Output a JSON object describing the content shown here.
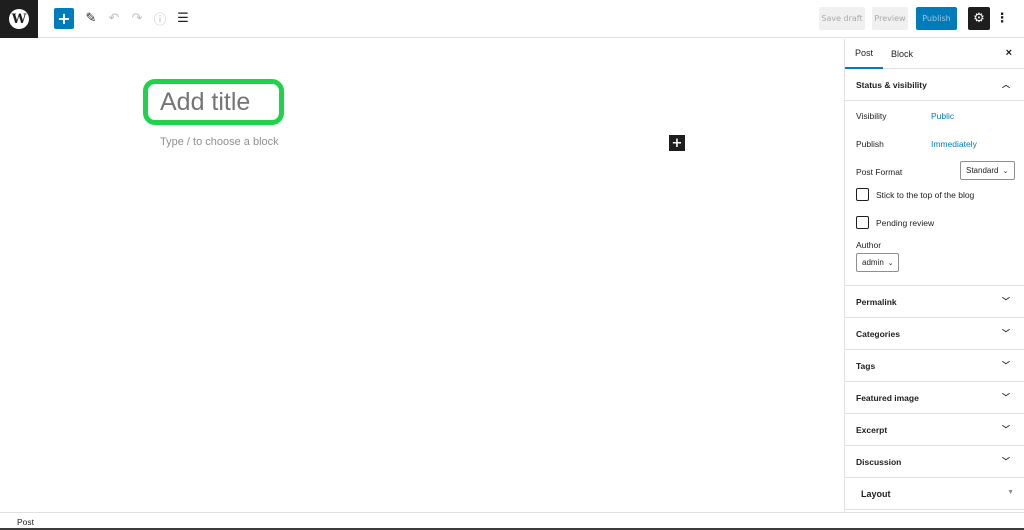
{
  "toolbar": {
    "logo_icon": "wordpress-logo",
    "add_block_label": "+",
    "tools_icon": "pencil-icon",
    "undo_icon": "undo-icon",
    "redo_icon": "redo-icon",
    "info_icon": "info-icon",
    "list_view_icon": "list-view-icon",
    "save_draft_label": "Save draft",
    "preview_label": "Preview",
    "publish_label": "Publish",
    "settings_icon": "gear-icon",
    "more_icon": "more-vertical-icon"
  },
  "editor": {
    "title_placeholder": "Add title",
    "block_placeholder": "Type / to choose a block",
    "inserter_label": "+"
  },
  "sidebar": {
    "tabs": [
      {
        "label": "Post",
        "active": true
      },
      {
        "label": "Block",
        "active": false
      }
    ],
    "close_label": "×",
    "status_panel": {
      "title": "Status & visibility",
      "visibility_label": "Visibility",
      "visibility_value": "Public",
      "publish_label": "Publish",
      "publish_value": "Immediately",
      "post_format_label": "Post Format",
      "post_format_value": "Standard",
      "sticky_label": "Stick to the top of the blog",
      "sticky_checked": false,
      "pending_label": "Pending review",
      "pending_checked": false,
      "author_label": "Author",
      "author_value": "admin"
    },
    "panels": [
      {
        "title": "Permalink"
      },
      {
        "title": "Categories"
      },
      {
        "title": "Tags"
      },
      {
        "title": "Featured image"
      },
      {
        "title": "Excerpt"
      },
      {
        "title": "Discussion"
      }
    ],
    "layout_panel": {
      "title": "Layout"
    }
  },
  "footer": {
    "breadcrumb": "Post"
  },
  "colors": {
    "accent": "#007cba",
    "highlight": "#1ed34a",
    "dark": "#1e1e1e"
  }
}
